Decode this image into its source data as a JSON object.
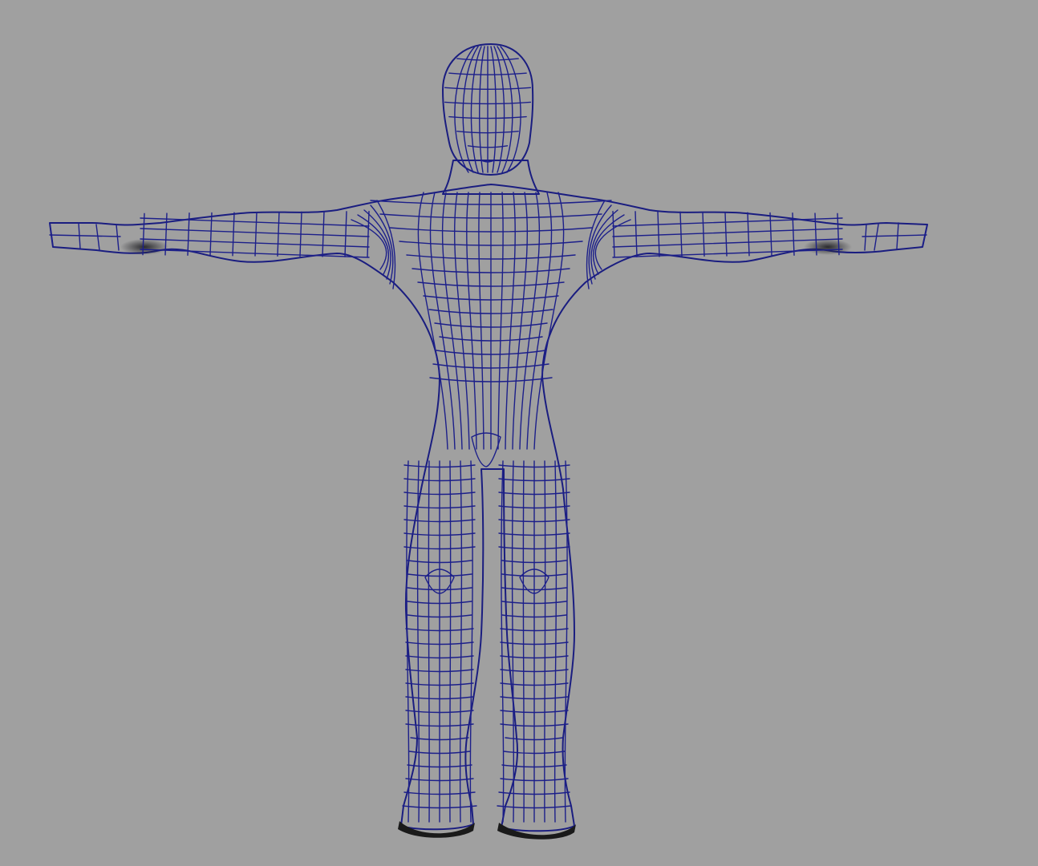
{
  "viewport": {
    "background_color": "#a0a0a0",
    "mesh_wire_color": "#1c1f8a",
    "mesh_surface_color": "#a8a8ae",
    "shadow_color": "#1a1a1a",
    "subject": "t-pose-humanoid-mesh",
    "display_mode": "wireframe-on-shaded"
  }
}
